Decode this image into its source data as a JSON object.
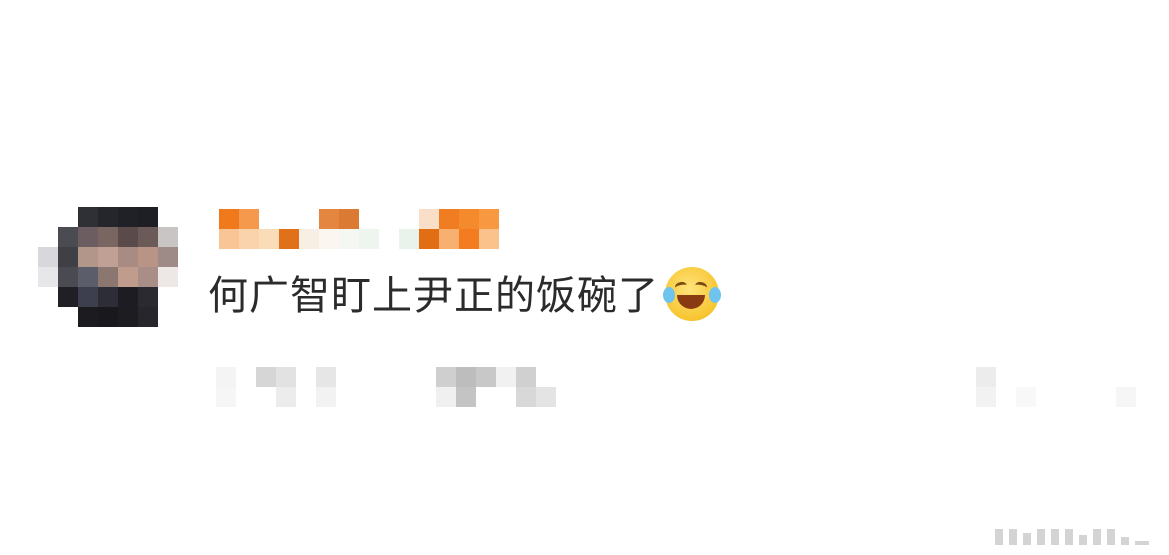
{
  "comment": {
    "text": "何广智盯上尹正的饭碗了",
    "emoji": "laughing-crying-emoji"
  },
  "colors": {
    "text": "#2b2b2b",
    "username_accent": "#f07a1c",
    "background": "#ffffff"
  }
}
